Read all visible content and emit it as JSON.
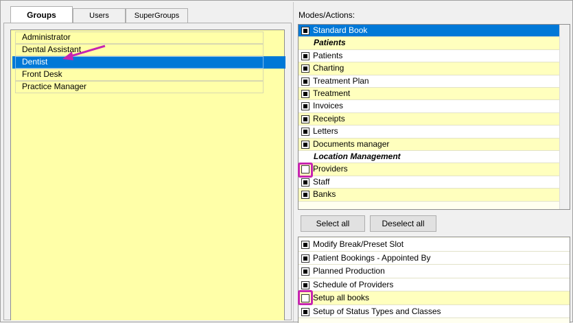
{
  "tabs": [
    {
      "label": "Groups",
      "active": true
    },
    {
      "label": "Users",
      "active": false
    },
    {
      "label": "SuperGroups",
      "active": false
    }
  ],
  "groups": [
    {
      "label": "Administrator",
      "selected": false
    },
    {
      "label": "Dental Assistant",
      "selected": false
    },
    {
      "label": "Dentist",
      "selected": true
    },
    {
      "label": "Front Desk",
      "selected": false
    },
    {
      "label": "Practice Manager",
      "selected": false
    }
  ],
  "modes_title": "Modes/Actions:",
  "modes": [
    {
      "label": "Standard Book",
      "checked": true,
      "type": "item",
      "selected": true
    },
    {
      "label": "Patients",
      "type": "header"
    },
    {
      "label": "Patients",
      "checked": true,
      "type": "item"
    },
    {
      "label": "Charting",
      "checked": true,
      "type": "item"
    },
    {
      "label": "Treatment Plan",
      "checked": true,
      "type": "item"
    },
    {
      "label": "Treatment",
      "checked": true,
      "type": "item"
    },
    {
      "label": "Invoices",
      "checked": true,
      "type": "item"
    },
    {
      "label": "Receipts",
      "checked": true,
      "type": "item"
    },
    {
      "label": "Letters",
      "checked": true,
      "type": "item"
    },
    {
      "label": "Documents manager",
      "checked": true,
      "type": "item"
    },
    {
      "label": "Location Management",
      "type": "header"
    },
    {
      "label": "Providers",
      "checked": false,
      "type": "item",
      "highlighted": true
    },
    {
      "label": "Staff",
      "checked": true,
      "type": "item"
    },
    {
      "label": "Banks",
      "checked": true,
      "type": "item"
    }
  ],
  "buttons": {
    "select_all": "Select all",
    "deselect_all": "Deselect all"
  },
  "actions": [
    {
      "label": "Modify Break/Preset Slot",
      "checked": true
    },
    {
      "label": "Patient Bookings - Appointed By",
      "checked": true
    },
    {
      "label": "Planned Production",
      "checked": true
    },
    {
      "label": "Schedule of Providers",
      "checked": true
    },
    {
      "label": "Setup all books",
      "checked": false,
      "highlighted": true
    },
    {
      "label": "Setup of Status Types and Classes",
      "checked": true
    }
  ],
  "colors": {
    "selection": "#0078d7",
    "list_yellow": "#ffffa8",
    "highlight_magenta": "#c724b1"
  }
}
